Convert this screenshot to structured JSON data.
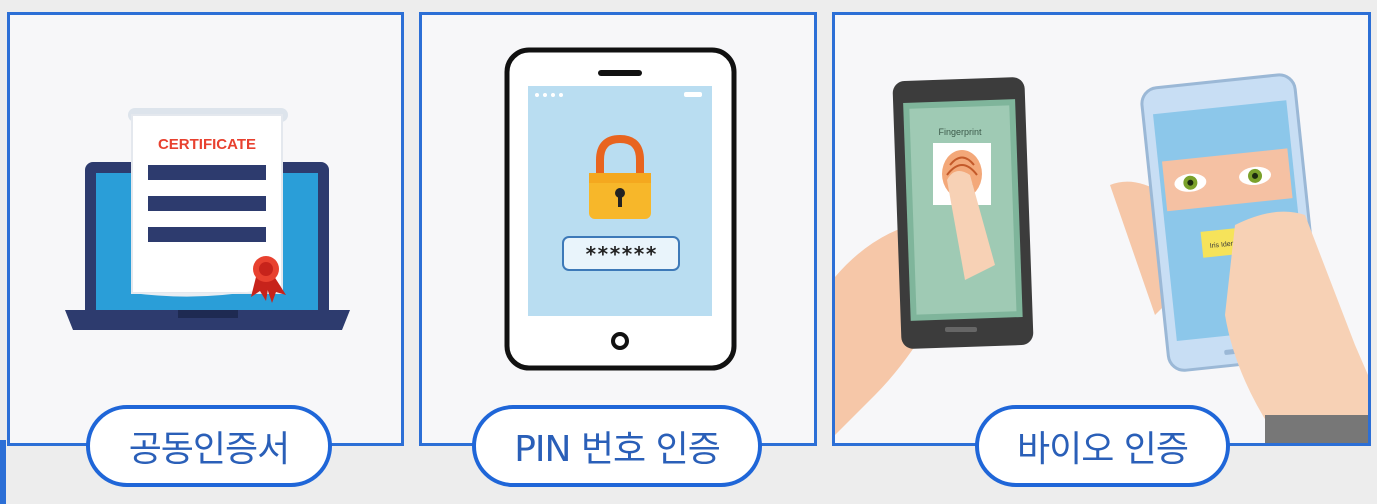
{
  "cards": [
    {
      "id": "certificate",
      "label": "공동인증서",
      "illustration": "laptop-certificate",
      "certificate_text": "CERTIFICATE"
    },
    {
      "id": "pin",
      "label": "PIN 번호 인증",
      "illustration": "tablet-lock",
      "pin_mask": "******"
    },
    {
      "id": "bio",
      "label": "바이오 인증",
      "illustration": "phones-fingerprint-iris",
      "fingerprint_text": "Fingerprint",
      "iris_text": "Iris Identification"
    }
  ],
  "colors": {
    "accent": "#1f66d8",
    "card_border": "#2c6fd6",
    "label_text": "#2a5fb8"
  }
}
